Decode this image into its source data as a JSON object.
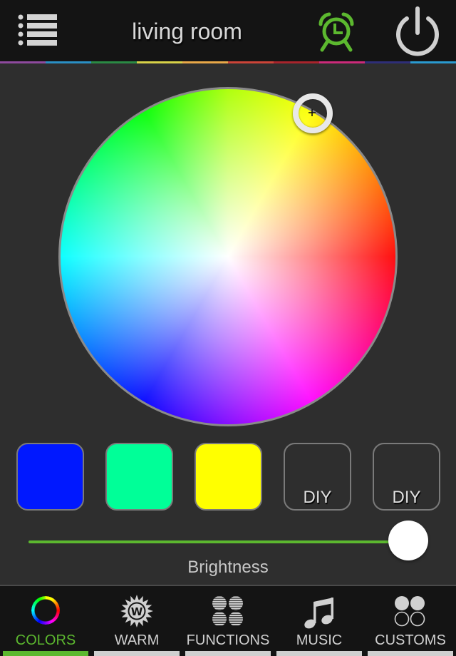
{
  "header": {
    "title": "living room",
    "menu_icon": "list-menu-icon",
    "alarm_icon": "alarm-clock-icon",
    "power_icon": "power-icon",
    "alarm_color": "#5cb82f",
    "rainbow_colors": [
      "#8e4a9e",
      "#2a8fc4",
      "#2a8a44",
      "#d8d248",
      "#e8a848",
      "#cc4438",
      "#a8242c",
      "#cc2a7a",
      "#2e2e78",
      "#2a9ad0"
    ]
  },
  "color_wheel": {
    "selected_color": "#ffff00",
    "selected_hue_deg": 60
  },
  "swatches": [
    {
      "color": "#0018ff",
      "label": ""
    },
    {
      "color": "#00ff98",
      "label": ""
    },
    {
      "color": "#ffff00",
      "label": ""
    },
    {
      "color": "",
      "label": "DIY"
    },
    {
      "color": "",
      "label": "DIY"
    }
  ],
  "brightness": {
    "label": "Brightness",
    "value_fraction": 1.0,
    "track_color": "#5cb82f"
  },
  "tabs": [
    {
      "label": "COLORS",
      "icon": "color-ring-icon",
      "active": true
    },
    {
      "label": "WARM",
      "icon": "warm-sun-icon",
      "active": false
    },
    {
      "label": "FUNCTIONS",
      "icon": "functions-grid-icon",
      "active": false
    },
    {
      "label": "MUSIC",
      "icon": "music-note-icon",
      "active": false
    },
    {
      "label": "CUSTOMS",
      "icon": "customs-circles-icon",
      "active": false
    }
  ],
  "accent_color": "#5cb82f"
}
